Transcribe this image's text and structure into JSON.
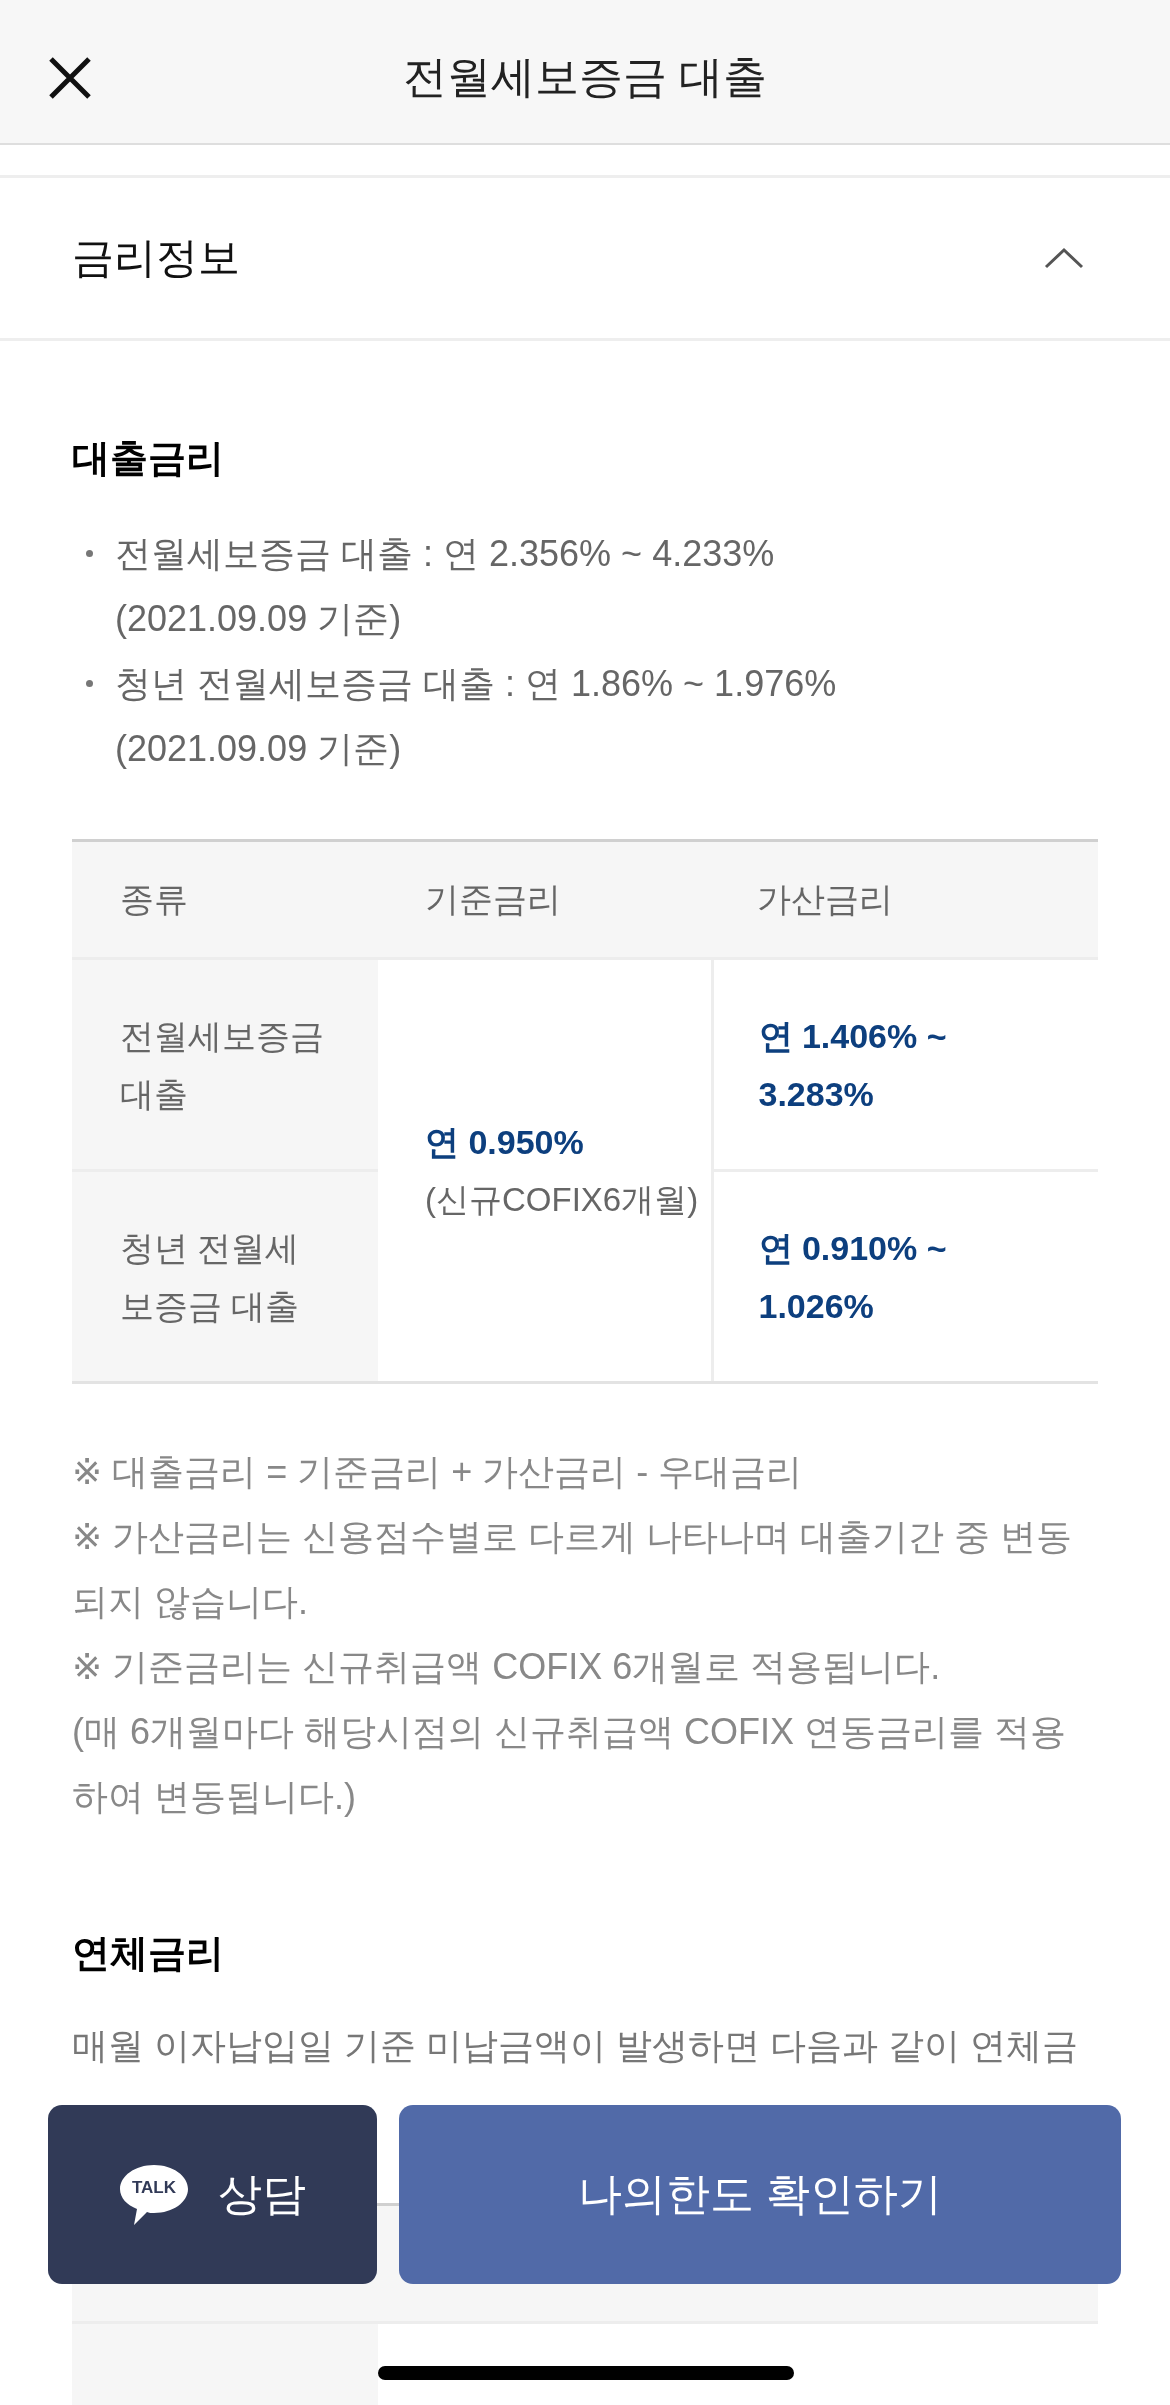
{
  "header": {
    "title": "전월세보증금 대출"
  },
  "accordion": {
    "title": "금리정보",
    "expanded": true
  },
  "loan_rate": {
    "heading": "대출금리",
    "bullets": [
      {
        "label": "전월세보증금 대출 : 연 2.356% ~ 4.233%",
        "basis": "(2021.09.09 기준)"
      },
      {
        "label": "청년 전월세보증금 대출 : 연 1.86% ~ 1.976%",
        "basis": "(2021.09.09 기준)"
      }
    ],
    "table": {
      "columns": [
        "종류",
        "기준금리",
        "가산금리"
      ],
      "base_rate": {
        "value": "연 0.950%",
        "note": "(신규COFIX6개월)"
      },
      "rows": [
        {
          "type": "전월세보증금 대출",
          "spread": "연 1.406% ~ 3.283%"
        },
        {
          "type": "청년 전월세보증금 대출",
          "spread": "연 0.910% ~ 1.026%"
        }
      ]
    },
    "notes": [
      "※ 대출금리 = 기준금리 + 가산금리 - 우대금리",
      "※ 가산금리는 신용점수별로 다르게 나타나며 대출기간 중 변동되지 않습니다.",
      "※ 기준금리는 신규취급액 COFIX 6개월로 적용됩니다.",
      "(매 6개월마다 해당시점의 신규취급액 COFIX 연동금리를 적용하여 변동됩니다.)"
    ]
  },
  "overdue_rate": {
    "heading": "연체금리",
    "text": "매월 이자납입일 기준 미납금액이 발생하면 다음과 같이 연체금"
  },
  "bottom_bar": {
    "consult_button": {
      "icon_text": "TALK",
      "label": "상담"
    },
    "primary_button": {
      "label": "나의한도 확인하기"
    }
  }
}
